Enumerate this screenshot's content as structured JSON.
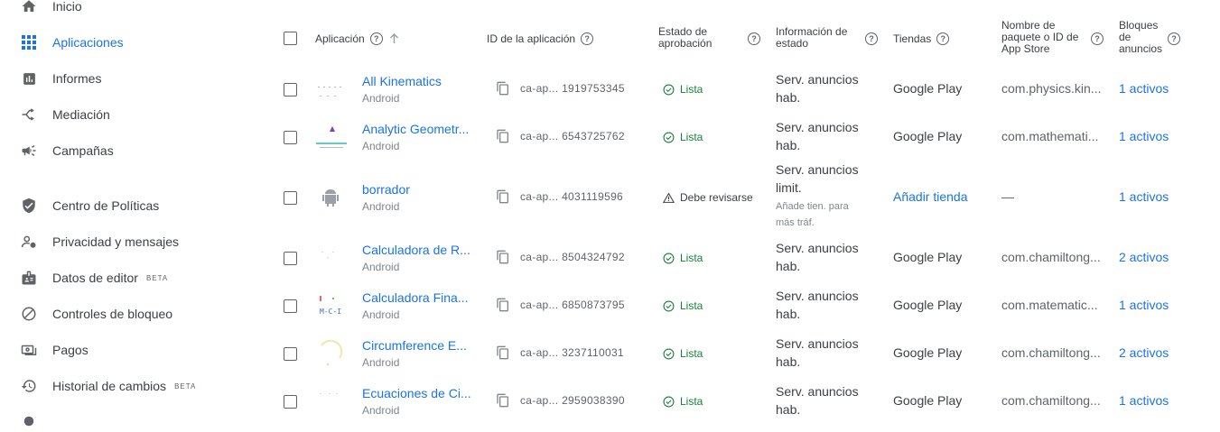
{
  "sidebar": {
    "items": [
      {
        "label": "Inicio",
        "icon": "home-icon"
      },
      {
        "label": "Aplicaciones",
        "icon": "apps-grid-icon",
        "active": true
      },
      {
        "label": "Informes",
        "icon": "reports-icon"
      },
      {
        "label": "Mediación",
        "icon": "mediation-icon"
      },
      {
        "label": "Campañas",
        "icon": "megaphone-icon"
      },
      {
        "label": "Centro de Políticas",
        "icon": "shield-icon"
      },
      {
        "label": "Privacidad y mensajes",
        "icon": "privacy-person-icon"
      },
      {
        "label": "Datos de editor",
        "icon": "publisher-id-icon",
        "badge": "BETA"
      },
      {
        "label": "Controles de bloqueo",
        "icon": "block-icon"
      },
      {
        "label": "Pagos",
        "icon": "payments-icon"
      },
      {
        "label": "Historial de cambios",
        "icon": "history-icon",
        "badge": "BETA"
      }
    ]
  },
  "table": {
    "headers": {
      "app": "Aplicación",
      "app_id": "ID de la aplicación",
      "approval_1": "Estado de",
      "approval_2": "aprobación",
      "info_1": "Información de",
      "info_2": "estado",
      "stores": "Tiendas",
      "pkg_1": "Nombre de",
      "pkg_2": "paquete o ID de",
      "pkg_3": "App Store",
      "blocks_1": "Bloques",
      "blocks_2": "de",
      "blocks_3": "anuncios"
    },
    "rows": [
      {
        "name": "All Kinematics",
        "platform": "Android",
        "id_prefix": "ca-ap...",
        "id": "1919753345",
        "status": "Lista",
        "info": [
          "Serv. anuncios",
          "hab."
        ],
        "store": "Google Play",
        "pkg": "com.physics.kin...",
        "blocks": "1 activos"
      },
      {
        "name": "Analytic Geometr...",
        "platform": "Android",
        "id_prefix": "ca-ap...",
        "id": "6543725762",
        "status": "Lista",
        "info": [
          "Serv. anuncios",
          "hab."
        ],
        "store": "Google Play",
        "pkg": "com.mathemati...",
        "blocks": "1 activos"
      },
      {
        "name": "borrador",
        "platform": "Android",
        "id_prefix": "ca-ap...",
        "id": "4031119596",
        "status": "Debe revisarse",
        "info": [
          "Serv. anuncios",
          "limit."
        ],
        "info_sub": [
          "Añade tien. para",
          "más tráf."
        ],
        "store": "Añadir tienda",
        "pkg": "—",
        "blocks": "1 activos"
      },
      {
        "name": "Calculadora de R...",
        "platform": "Android",
        "id_prefix": "ca-ap...",
        "id": "8504324792",
        "status": "Lista",
        "info": [
          "Serv. anuncios",
          "hab."
        ],
        "store": "Google Play",
        "pkg": "com.chamiltong...",
        "blocks": "2 activos"
      },
      {
        "name": "Calculadora Fina...",
        "platform": "Android",
        "id_prefix": "ca-ap...",
        "id": "6850873795",
        "status": "Lista",
        "info": [
          "Serv. anuncios",
          "hab."
        ],
        "store": "Google Play",
        "pkg": "com.matematic...",
        "blocks": "1 activos"
      },
      {
        "name": "Circumference E...",
        "platform": "Android",
        "id_prefix": "ca-ap...",
        "id": "3237110031",
        "status": "Lista",
        "info": [
          "Serv. anuncios",
          "hab."
        ],
        "store": "Google Play",
        "pkg": "com.chamiltong...",
        "blocks": "2 activos"
      },
      {
        "name": "Ecuaciones de Ci...",
        "platform": "Android",
        "id_prefix": "ca-ap...",
        "id": "2959038390",
        "status": "Lista",
        "info": [
          "Serv. anuncios",
          "hab."
        ],
        "store": "Google Play",
        "pkg": "com.chamiltong...",
        "blocks": "1 activos"
      }
    ]
  },
  "colors": {
    "accent": "#1a73e8",
    "ok": "#188038",
    "muted": "#80868b"
  }
}
